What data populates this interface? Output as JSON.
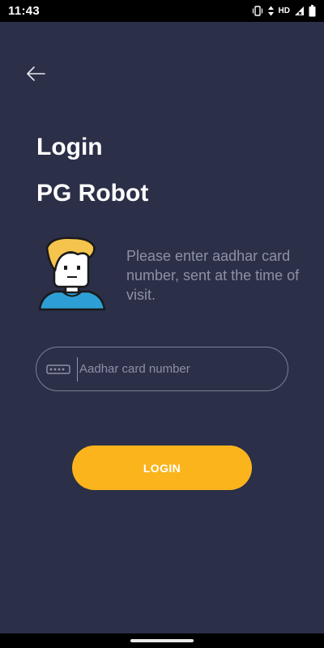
{
  "status_bar": {
    "time": "11:43",
    "network_label": "HD",
    "icons": [
      "vibrate-icon",
      "data-arrows-icon",
      "signal-icon",
      "battery-icon"
    ]
  },
  "header": {
    "back_icon": "arrow-left-icon"
  },
  "titles": {
    "login": "Login",
    "app_name": "PG Robot"
  },
  "instruction": {
    "text": "Please enter aadhar card number, sent at the time of visit."
  },
  "form": {
    "input_icon": "password-key-icon",
    "placeholder": "Aadhar card number",
    "value": "",
    "login_label": "LOGIN"
  },
  "colors": {
    "background": "#2b2f48",
    "accent": "#fbb41c",
    "muted_text": "#8d90a6"
  }
}
